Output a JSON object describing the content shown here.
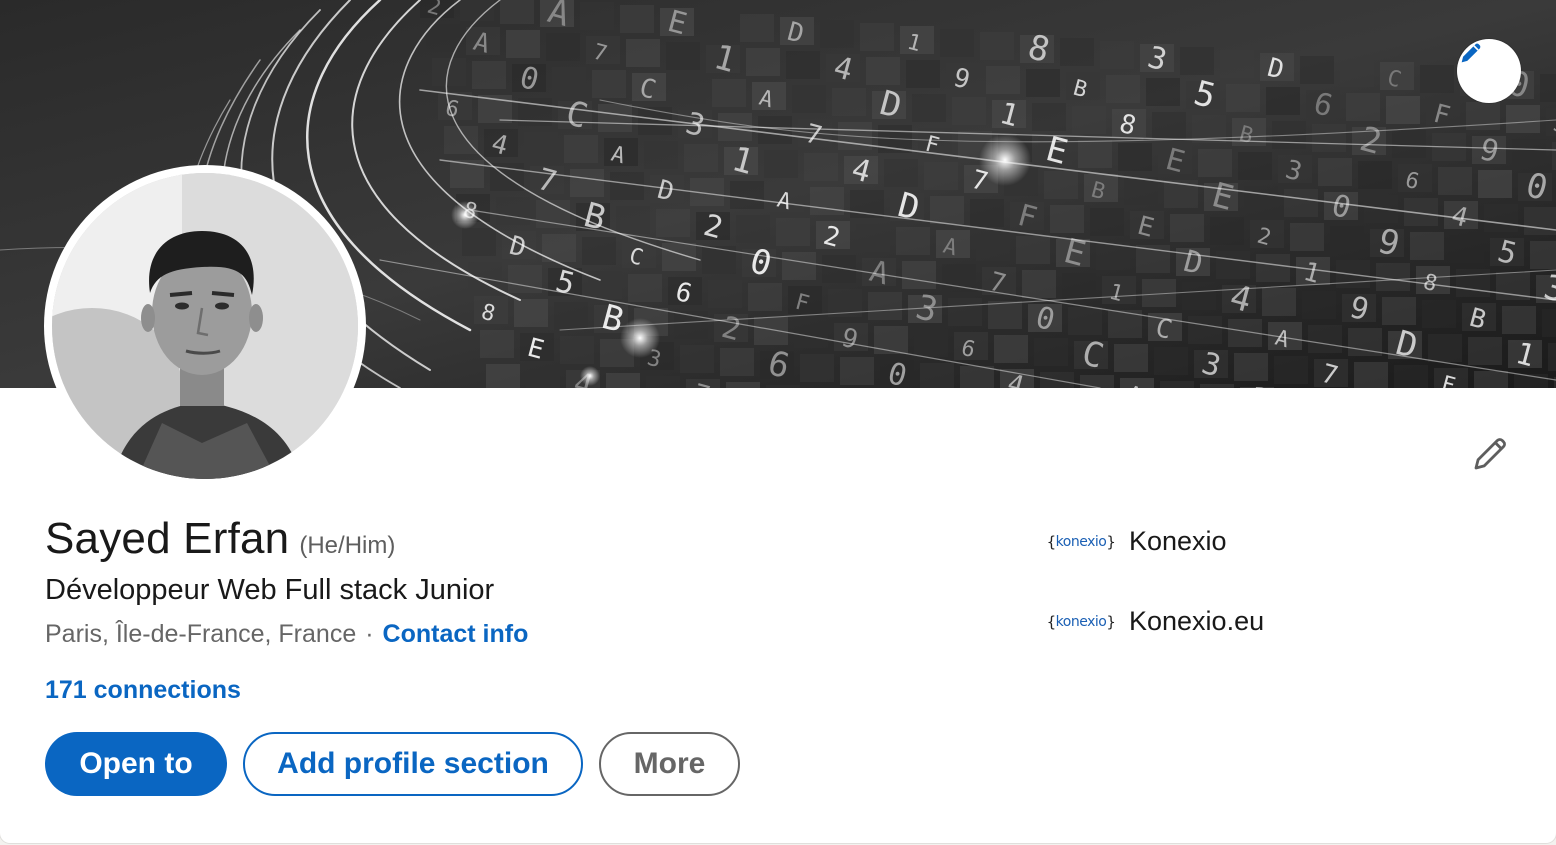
{
  "profile": {
    "name": "Sayed Erfan",
    "pronouns": "(He/Him)",
    "headline": "Développeur Web Full stack Junior",
    "location": "Paris, Île-de-France, France",
    "separator": "·",
    "contact_label": "Contact info",
    "connections_label": "171 connections"
  },
  "actions": {
    "open_to": "Open to",
    "add_section": "Add profile section",
    "more": "More"
  },
  "organizations": [
    {
      "logo_text": "konexio",
      "name": "Konexio"
    },
    {
      "logo_text": "konexio",
      "name": "Konexio.eu"
    }
  ],
  "banner": {
    "glyphs": [
      "2",
      "A",
      "E",
      "D",
      "1",
      "8",
      "3",
      "D",
      "C",
      "0",
      "A",
      "7",
      "1",
      "4",
      "9",
      "B",
      "5",
      "6",
      "F",
      "3",
      "0",
      "C",
      "A",
      "D",
      "1",
      "8",
      "B",
      "2",
      "9",
      "6",
      "C",
      "3",
      "7",
      "F",
      "E",
      "E",
      "3",
      "6",
      "0",
      "4",
      "A",
      "1",
      "4",
      "7",
      "B",
      "E",
      "0",
      "4",
      "7",
      "D",
      "A",
      "D",
      "F",
      "E",
      "2",
      "9",
      "5",
      "8",
      "B",
      "2"
    ]
  },
  "colors": {
    "accent": "#0a66c2",
    "text_primary": "#191919",
    "text_secondary": "#666666",
    "banner_bg": "#1b1b1b"
  },
  "icons": {
    "banner_edit": "pencil-icon",
    "intro_edit": "pencil-outline-icon"
  }
}
